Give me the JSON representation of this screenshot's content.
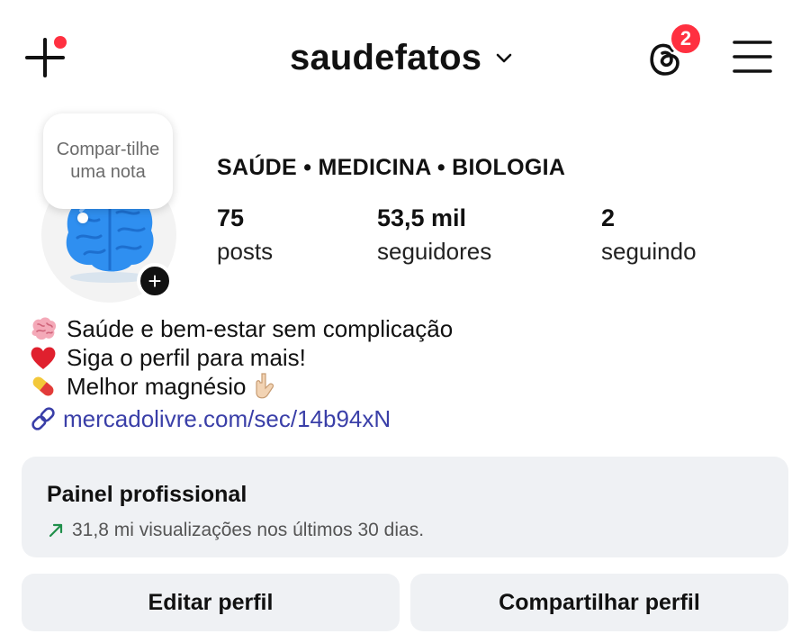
{
  "header": {
    "username": "saudefatos",
    "threads_badge_count": "2",
    "colors": {
      "badge": "#ff3040",
      "link": "#3a3fa8",
      "trend_arrow": "#1f8f4a"
    }
  },
  "profile": {
    "note_placeholder": "Compar-tilhe uma nota",
    "category": "SAÚDE • MEDICINA • BIOLOGIA",
    "stats": {
      "posts": {
        "value": "75",
        "label": "posts"
      },
      "followers": {
        "value": "53,5 mil",
        "label": "seguidores"
      },
      "following": {
        "value": "2",
        "label": "seguindo"
      }
    }
  },
  "bio": {
    "lines": [
      {
        "emoji": "brain-icon",
        "text": "Saúde e bem-estar sem complicação"
      },
      {
        "emoji": "heart-icon",
        "text": "Siga o perfil para mais!"
      },
      {
        "emoji": "pill-icon",
        "text": "Melhor magnésio"
      }
    ],
    "link": "mercadolivre.com/sec/14b94xN"
  },
  "professional_panel": {
    "title": "Painel profissional",
    "subtitle": "31,8 mi visualizações nos últimos 30 dias."
  },
  "buttons": {
    "edit": "Editar perfil",
    "share": "Compartilhar perfil"
  }
}
